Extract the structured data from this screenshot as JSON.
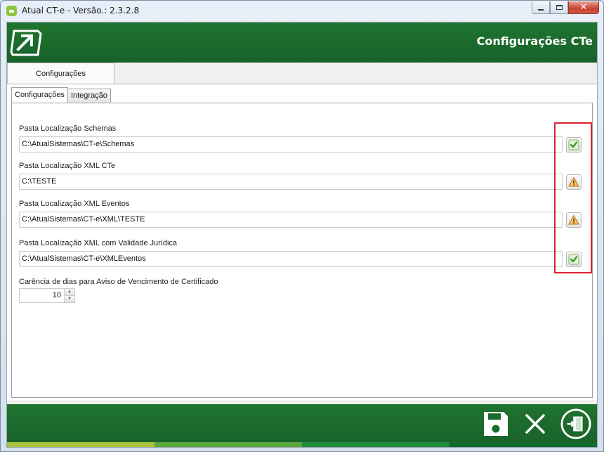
{
  "window": {
    "title": "Atual CT-e - Versão.: 2.3.2.8"
  },
  "header": {
    "title": "Configurações CTe"
  },
  "outer_tabs": [
    {
      "label": "Configurações"
    }
  ],
  "inner_tabs": [
    {
      "label": "Configurações"
    },
    {
      "label": "Integração"
    }
  ],
  "fields": [
    {
      "label": "Pasta Localização Schemas",
      "value": "C:\\AtualSistemas\\CT-e\\Schemas",
      "status": "check-icon"
    },
    {
      "label": "Pasta Localização XML CTe",
      "value": "C:\\TESTE",
      "status": "warning-icon"
    },
    {
      "label": "Pasta Localização XML Eventos",
      "value": "C:\\AtualSistemas\\CT-e\\XML\\TESTE",
      "status": "warning-icon"
    },
    {
      "label": "Pasta Localização XML com Validade Jurídica",
      "value": "C:\\AtualSistemas\\CT-e\\XMLEventos",
      "status": "check-icon"
    }
  ],
  "certificate": {
    "label": "Carência de dias para Aviso de Vencimento de Certificado",
    "value": "10"
  },
  "icons": {
    "app": "app-logo-icon",
    "header_logo": "arrow-logo-icon",
    "save": "floppy-disk-icon",
    "cancel": "close-x-icon",
    "exit": "exit-door-icon"
  },
  "colors": {
    "brand_green": "#1b6b2d",
    "stripe": [
      "#a9c23f",
      "#5aa63d",
      "#1e8c3a",
      "#0f6a2e"
    ],
    "highlight": "#d9232f",
    "check": "#3a9a2a",
    "warning": "#e8a23a"
  }
}
